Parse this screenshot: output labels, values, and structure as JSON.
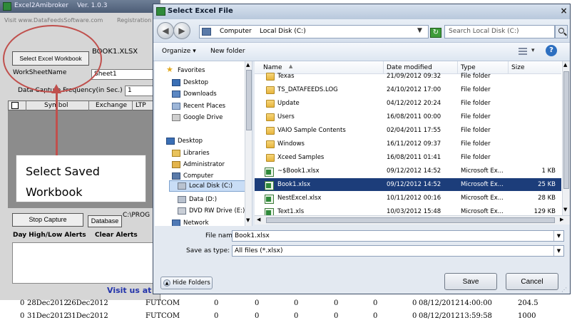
{
  "background_app": {
    "title": "Excel2Amibroker",
    "version": "Ver. 1.0.3",
    "visit_text": "Visit www.DataFeedsSoftware.com",
    "registration_text": "Registration",
    "select_workbook_label": "Select Excel Workbook",
    "workbook_file": "BOOK1.XLSX",
    "worksheet_label": "WorkSheetName",
    "worksheet_value": "Sheet1",
    "frequency_label": "Data Capture Frequency(in Sec.)",
    "frequency_value": "1",
    "grid_columns": [
      "Symbol",
      "Exchange",
      "LTP"
    ],
    "stop_capture_label": "Stop Capture",
    "database_label": "Database",
    "path_fragment": "C:\\PROG",
    "alerts_label": "Day High/Low Alerts",
    "clear_alerts_label": "Clear Alerts",
    "visit_link": "Visit us at"
  },
  "annotation": {
    "line1": "Select Saved",
    "line2": "Workbook",
    "color": "#c0504d"
  },
  "data_rows": [
    [
      "0",
      "28Dec2012",
      "26Dec2012",
      "FUTCOM",
      "0",
      "0",
      "0",
      "0",
      "0",
      "0",
      "08/12/2012",
      "14:00:00",
      "204.5"
    ],
    [
      "0",
      "31Dec2012",
      "31Dec2012",
      "FUTCOM",
      "0",
      "0",
      "0",
      "0",
      "0",
      "0",
      "08/12/2012",
      "13:59:58",
      "1000"
    ]
  ],
  "dialog": {
    "title": "Select Excel File",
    "close_label": "×",
    "address": [
      "Computer",
      "Local Disk (C:)"
    ],
    "search_placeholder": "Search Local Disk (C:)",
    "organize_label": "Organize",
    "new_folder_label": "New folder",
    "help_label": "?",
    "nav_items": [
      {
        "label": "Favorites",
        "icon": "star-icon"
      },
      {
        "label": "Desktop",
        "icon": "desktop-icon"
      },
      {
        "label": "Downloads",
        "icon": "downloads-icon"
      },
      {
        "label": "Recent Places",
        "icon": "recent-places-icon"
      },
      {
        "label": "Google Drive",
        "icon": "drive-icon"
      },
      {
        "label": "Desktop",
        "icon": "desktop-icon"
      },
      {
        "label": "Libraries",
        "icon": "libraries-icon"
      },
      {
        "label": "Administrator",
        "icon": "user-icon"
      },
      {
        "label": "Computer",
        "icon": "computer-icon"
      },
      {
        "label": "Local Disk (C:)",
        "icon": "disk-icon"
      },
      {
        "label": "Data (D:)",
        "icon": "disk-icon"
      },
      {
        "label": "DVD RW Drive (E:)",
        "icon": "dvd-icon"
      },
      {
        "label": "Network",
        "icon": "network-icon"
      }
    ],
    "columns": [
      "Name",
      "Date modified",
      "Type",
      "Size"
    ],
    "files": [
      {
        "name": "Texas",
        "date": "21/09/2012 09:32",
        "type": "File folder",
        "size": "",
        "kind": "folder"
      },
      {
        "name": "TS_DATAFEEDS.LOG",
        "date": "24/10/2012 17:00",
        "type": "File folder",
        "size": "",
        "kind": "folder"
      },
      {
        "name": "Update",
        "date": "04/12/2012 20:24",
        "type": "File folder",
        "size": "",
        "kind": "folder"
      },
      {
        "name": "Users",
        "date": "16/08/2011 00:00",
        "type": "File folder",
        "size": "",
        "kind": "folder"
      },
      {
        "name": "VAIO Sample Contents",
        "date": "02/04/2011 17:55",
        "type": "File folder",
        "size": "",
        "kind": "folder"
      },
      {
        "name": "Windows",
        "date": "16/11/2012 09:37",
        "type": "File folder",
        "size": "",
        "kind": "folder"
      },
      {
        "name": "Xceed Samples",
        "date": "16/08/2011 01:41",
        "type": "File folder",
        "size": "",
        "kind": "folder"
      },
      {
        "name": "~$Book1.xlsx",
        "date": "09/12/2012 14:52",
        "type": "Microsoft Ex...",
        "size": "1 KB",
        "kind": "xls"
      },
      {
        "name": "Book1.xlsx",
        "date": "09/12/2012 14:52",
        "type": "Microsoft Ex...",
        "size": "25 KB",
        "kind": "xls",
        "selected": true
      },
      {
        "name": "NestExcel.xlsx",
        "date": "10/11/2012 00:16",
        "type": "Microsoft Ex...",
        "size": "28 KB",
        "kind": "xls"
      },
      {
        "name": "Text1.xls",
        "date": "10/03/2012 15:48",
        "type": "Microsoft Ex...",
        "size": "129 KB",
        "kind": "xls"
      }
    ],
    "file_name_label": "File name:",
    "file_name_value": "Book1.xlsx",
    "save_as_label": "Save as type:",
    "save_as_value": "All files (*.xlsx)",
    "hide_folders_label": "Hide Folders",
    "save_label": "Save",
    "cancel_label": "Cancel"
  }
}
